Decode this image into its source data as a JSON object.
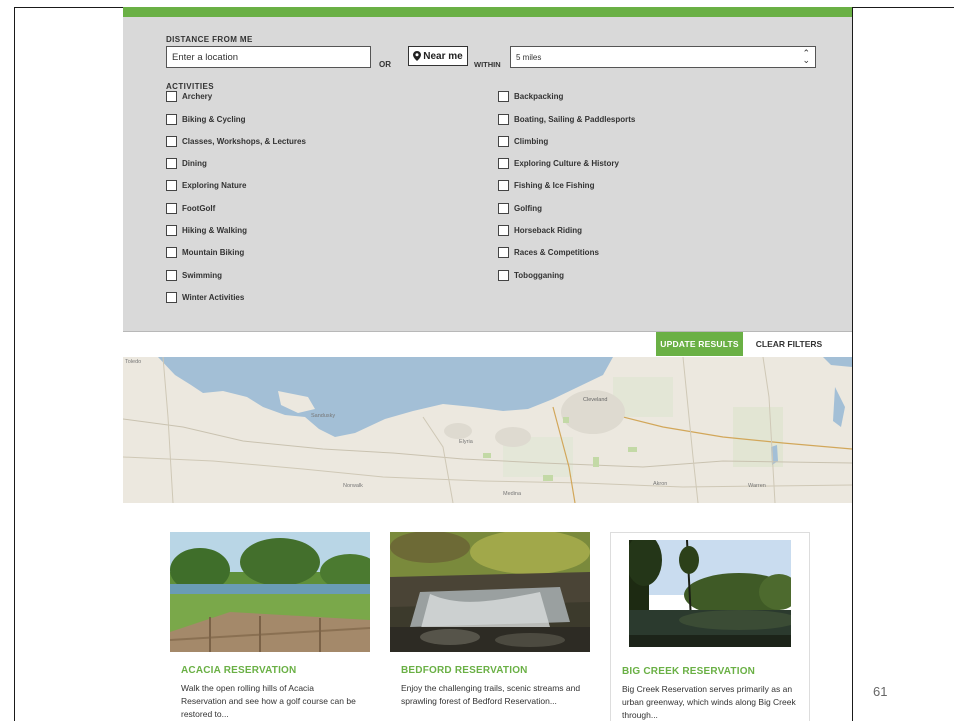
{
  "slide": {
    "page_number": "61"
  },
  "filters": {
    "distance_label": "DISTANCE FROM ME",
    "location_placeholder": "Enter a location",
    "or_label": "OR",
    "near_me_label": "Near me",
    "within_label": "WITHIN",
    "distance_value": "5 miles",
    "activities_label": "ACTIVITIES",
    "activities": [
      "Archery",
      "Backpacking",
      "Biking & Cycling",
      "Boating, Sailing & Paddlesports",
      "Classes, Workshops, & Lectures",
      "Climbing",
      "Dining",
      "Exploring Culture & History",
      "Exploring Nature",
      "Fishing & Ice Fishing",
      "FootGolf",
      "Golfing",
      "Hiking & Walking",
      "Horseback Riding",
      "Mountain Biking",
      "Races & Competitions",
      "Swimming",
      "Tobogganing",
      "Winter Activities"
    ],
    "update_label": "UPDATE RESULTS",
    "clear_label": "CLEAR FILTERS"
  },
  "map": {
    "labels": [
      "Toledo",
      "Sandusky",
      "Elyria",
      "Cleveland",
      "Akron",
      "Warren",
      "Norwalk",
      "Medina"
    ]
  },
  "cards": [
    {
      "title": "ACACIA RESERVATION",
      "description": "Walk the open rolling hills of Acacia Reservation and see how a golf course can be restored to..."
    },
    {
      "title": "BEDFORD RESERVATION",
      "description": "Enjoy the challenging trails, scenic streams and sprawling forest of Bedford Reservation..."
    },
    {
      "title": "BIG CREEK RESERVATION",
      "description": "Big Creek Reservation serves primarily as an urban greenway, which winds along Big Creek through..."
    }
  ],
  "colors": {
    "accent_green": "#6ab045",
    "panel_gray": "#d9d9d9",
    "lake_blue": "#a3bfd6"
  }
}
